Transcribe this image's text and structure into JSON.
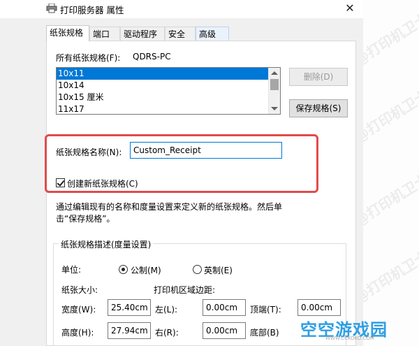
{
  "window": {
    "title": "打印服务器 属性",
    "close_glyph": "✕"
  },
  "tabs": [
    "纸张规格",
    "端口",
    "驱动程序",
    "安全",
    "高级"
  ],
  "forms": {
    "all_forms_label": "所有纸张规格(F):",
    "server_name": "QDRS-PC",
    "list": [
      "10x11",
      "10x14",
      "10x15 厘米",
      "11x17"
    ],
    "selected_index": 0,
    "delete_button": "删除(D)",
    "save_button": "保存规格(S)"
  },
  "edit": {
    "name_label": "纸张规格名称(N):",
    "name_value": "Custom_Receipt",
    "create_new_label": "创建新纸张规格(C)",
    "create_new_checked": true
  },
  "help_text": {
    "line1": "通过编辑现有的名称和度量设置来定义新的纸张规格。然后单",
    "line2": "击“保存规格”。"
  },
  "description": {
    "group_title": "纸张规格描述(度量设置)",
    "units_label": "单位:",
    "metric_label": "公制(M)",
    "english_label": "英制(E)",
    "metric_selected": true,
    "paper_size_label": "纸张大小:",
    "margins_label": "打印机区域边距:",
    "width_label": "宽度(W):",
    "width_value": "25.40cm",
    "height_label": "高度(H):",
    "height_value": "27.94cm",
    "left_label": "左(L):",
    "left_value": "0.00cm",
    "right_label": "右(R):",
    "right_value": "0.00cm",
    "top_label": "顶端(T):",
    "top_value": "0.00cm",
    "bottom_label": "底部(B)"
  },
  "watermark": "@打印机卫士",
  "logo": {
    "text": "空空游戏园",
    "url": "WWW.CCKOKO.COM"
  },
  "colors": {
    "highlight": "#e24b4b",
    "selection": "#0078d7",
    "logo": "#2f9fe3"
  }
}
